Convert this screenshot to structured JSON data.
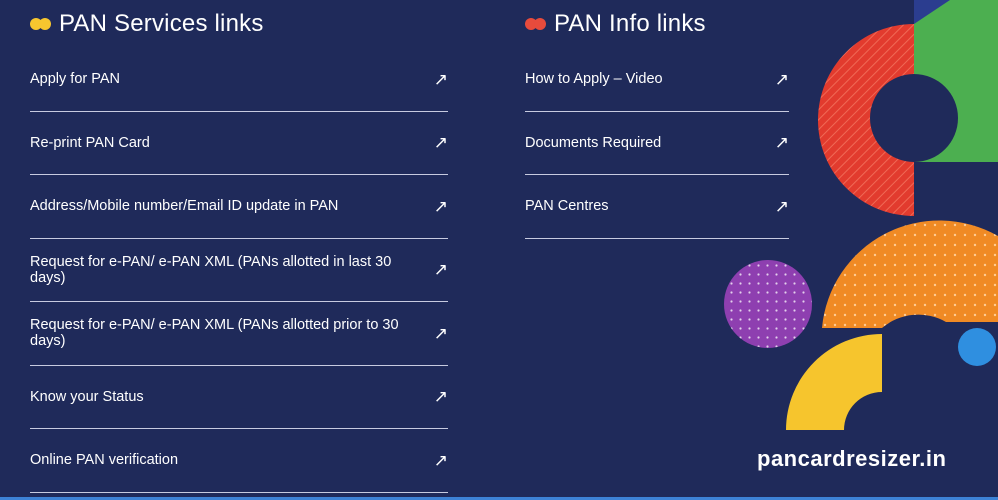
{
  "colors": {
    "background": "#1f2a5a",
    "services_dot": "#f7c62f",
    "info_dot": "#e74b3c",
    "link_underline": "#c7cbe0"
  },
  "services": {
    "title": "PAN Services links",
    "arrow_icon": "arrow-up-right-icon",
    "items": [
      {
        "label": "Apply for PAN"
      },
      {
        "label": "Re-print PAN Card"
      },
      {
        "label": "Address/Mobile number/Email ID update in PAN"
      },
      {
        "label": "Request for e-PAN/ e-PAN XML (PANs allotted in last 30 days)"
      },
      {
        "label": "Request for e-PAN/ e-PAN XML (PANs allotted prior to 30 days)"
      },
      {
        "label": "Know your Status"
      },
      {
        "label": "Online PAN verification"
      }
    ]
  },
  "info": {
    "title": "PAN Info links",
    "items": [
      {
        "label": "How to Apply – Video"
      },
      {
        "label": "Documents Required"
      },
      {
        "label": "PAN Centres"
      }
    ]
  },
  "watermark": "pancardresizer.in",
  "decoration": {
    "shapes": [
      "red-striped-half-ring",
      "green-half-disc",
      "orange-dotted-arch",
      "purple-dotted-circle",
      "yellow-quarter-ring",
      "blue-circle"
    ]
  }
}
